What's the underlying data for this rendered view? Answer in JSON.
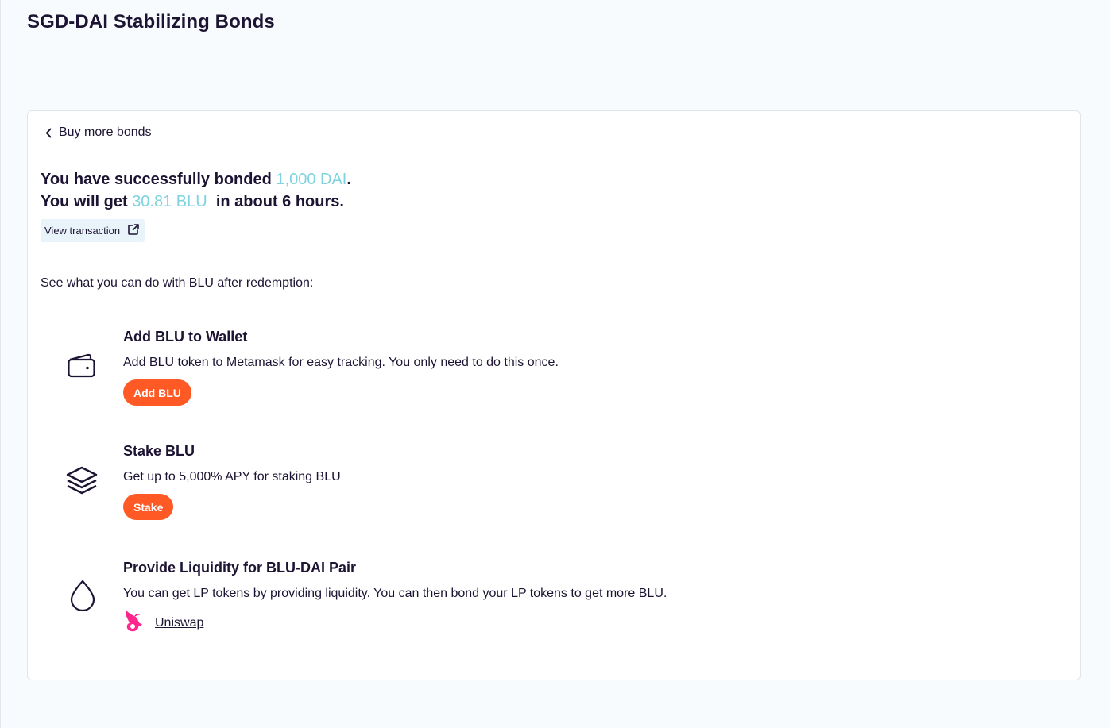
{
  "page": {
    "title": "SGD-DAI Stabilizing Bonds"
  },
  "back_link": {
    "label": "Buy more bonds",
    "icon": "chevron-left-icon"
  },
  "success": {
    "line1_prefix": "You have successfully bonded ",
    "line1_amount": "1,000 DAI",
    "line1_suffix": ".",
    "line2_prefix": "You will get ",
    "line2_amount": "30.81 BLU",
    "line2_suffix": " in about 6 hours.",
    "accent_color": "#7ed3de"
  },
  "view_transaction": {
    "label": "View transaction",
    "icon": "external-link-icon"
  },
  "intro_text": "See what you can do with BLU after redemption:",
  "actions": {
    "wallet": {
      "icon": "wallet-icon",
      "title": "Add BLU to Wallet",
      "description": "Add BLU token to Metamask for easy tracking. You only need to do this once.",
      "button_label": "Add BLU"
    },
    "stake": {
      "icon": "layers-icon",
      "title": "Stake BLU",
      "description": "Get up to 5,000% APY for staking BLU",
      "button_label": "Stake"
    },
    "liquidity": {
      "icon": "droplet-icon",
      "title": "Provide Liquidity for BLU-DAI Pair",
      "description": "You can get LP tokens by providing liquidity. You can then bond your LP tokens to get more BLU.",
      "link_label": "Uniswap",
      "link_icon": "uniswap-unicorn-icon"
    }
  },
  "colors": {
    "button": "#ff5a25",
    "text": "#1d1433",
    "uniswap_pink": "#ff007a"
  }
}
